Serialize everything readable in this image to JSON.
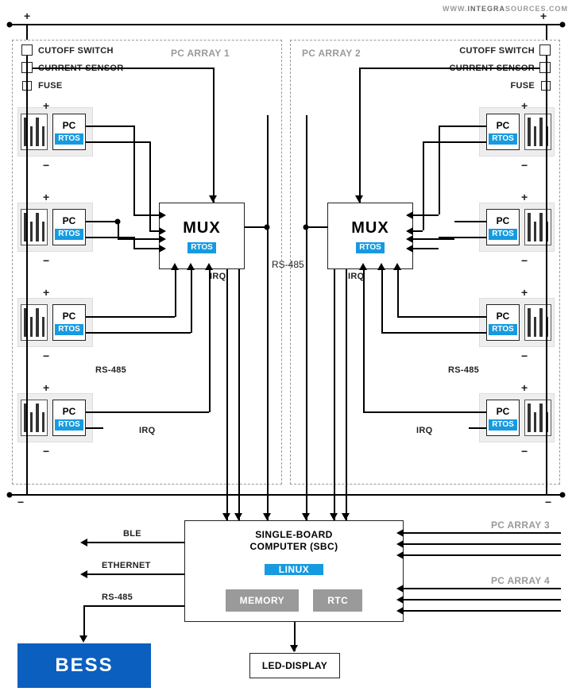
{
  "watermark": {
    "left": "WWW.",
    "mid": "INTEGRA",
    "right": "SOURCES",
    "suffix": ".COM"
  },
  "array1": {
    "title": "PC ARRAY 1",
    "cutoff": "CUTOFF SWITCH",
    "current": "CURRENT SENSOR",
    "fuse": "FUSE"
  },
  "array2": {
    "title": "PC ARRAY 2",
    "cutoff": "CUTOFF SWITCH",
    "current": "CURRENT SENSOR",
    "fuse": "FUSE"
  },
  "pc": {
    "label": "PC",
    "rtos": "RTOS"
  },
  "mux": {
    "label": "MUX",
    "rtos": "RTOS",
    "irq": "IRQ"
  },
  "signals": {
    "rs485": "RS-485",
    "irq": "IRQ"
  },
  "sbc": {
    "title1": "SINGLE-BOARD",
    "title2": "COMPUTER (SBC)",
    "linux": "LINUX",
    "memory": "MEMORY",
    "rtc": "RTC"
  },
  "left_comms": {
    "ble": "BLE",
    "ethernet": "ETHERNET",
    "rs485": "RS-485"
  },
  "right_ext": {
    "arr3": "PC ARRAY 3",
    "arr4": "PC ARRAY 4"
  },
  "bess": "BESS",
  "led": "LED-DISPLAY",
  "polarity": {
    "plus": "+",
    "minus": "−"
  }
}
